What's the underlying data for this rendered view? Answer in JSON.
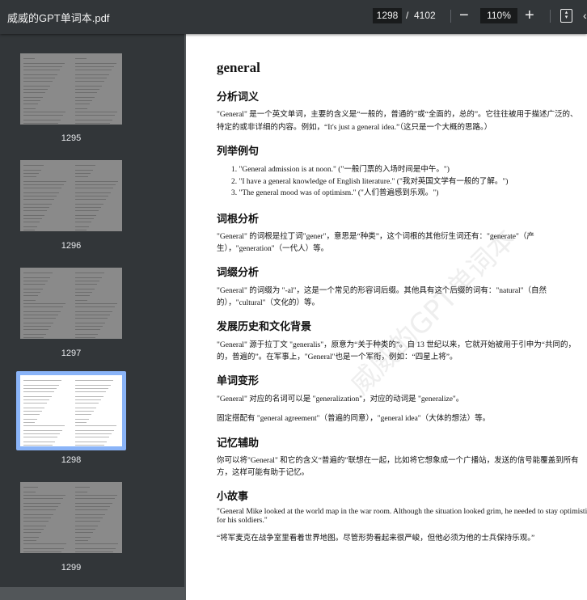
{
  "toolbar": {
    "title": "威威的GPT单词本.pdf",
    "current_page": "1298",
    "separator": "/",
    "total_pages": "4102",
    "zoom": "110%",
    "minus": "−",
    "plus": "+"
  },
  "thumbnails": [
    {
      "label": "1295"
    },
    {
      "label": "1296"
    },
    {
      "label": "1297"
    },
    {
      "label": "1298",
      "selected": true
    },
    {
      "label": "1299"
    }
  ],
  "accent_color": "#8ab4f8",
  "document": {
    "title": "general",
    "watermark": "威威的GPT单词本",
    "s1": {
      "heading": "分析词义",
      "lines": [
        "\"General\" 是一个英文单词，主要的含义是“一般的，普通的”或“全面的，总的”。它往往被用于描述广泛的、",
        "特定的或非详细的内容。例如，“It's just a general idea.”（这只是一个大概的思路。）"
      ]
    },
    "s2": {
      "heading": "列举例句",
      "items": [
        "1. \"General admission is at noon.\" (\"一般门票的入场时间是中午。\")",
        "2. \"I have a general knowledge of English literature.\" (\"我对英国文学有一般的了解。\")",
        "3. \"The general mood was of optimism.\" (\"人们普遍感到乐观。\")"
      ]
    },
    "s3": {
      "heading": "词根分析",
      "lines": [
        "\"General\" 的词根是拉丁词\"gener\"，意思是“种类”，这个词根的其他衍生词还有：\"generate\"（产",
        "生），\"generation\"（一代人）等。"
      ]
    },
    "s4": {
      "heading": "词缀分析",
      "lines": [
        "\"General\" 的词缀为 \"-al\"，这是一个常见的形容词后缀。其他具有这个后缀的词有：\"natural\"（自然",
        "的），\"cultural\"（文化的）等。"
      ]
    },
    "s5": {
      "heading": "发展历史和文化背景",
      "lines": [
        "\"General\" 源于拉丁文 \"generalis\"，原意为“关于种类的”。自 13 世纪以来，它就开始被用于引申为“共同的，",
        "的，普遍的”。在军事上，\"General\"也是一个军衔，例如：“四星上将”。"
      ]
    },
    "s6": {
      "heading": "单词变形",
      "p1": "\"General\" 对应的名词可以是 \"generalization\"，对应的动词是 \"generalize\"。",
      "p2": "固定搭配有 \"general agreement\"（普遍的同意），\"general idea\"（大体的想法）等。"
    },
    "s7": {
      "heading": "记忆辅助",
      "lines": [
        "你可以将\"General\" 和它的含义“普遍的”联想在一起，比如将它想象成一个广播站，发送的信号能覆盖到所有",
        "方，这样可能有助于记忆。"
      ]
    },
    "s8": {
      "heading": "小故事",
      "lines": [
        "\"General Mike looked at the world map in the war room. Although the situation looked grim, he needed to stay optimistic",
        "for his soldiers.\""
      ],
      "translation": "“将军麦克在战争室里看着世界地图。尽管形势看起来很严峻，但他必须为他的士兵保持乐观。”"
    }
  }
}
